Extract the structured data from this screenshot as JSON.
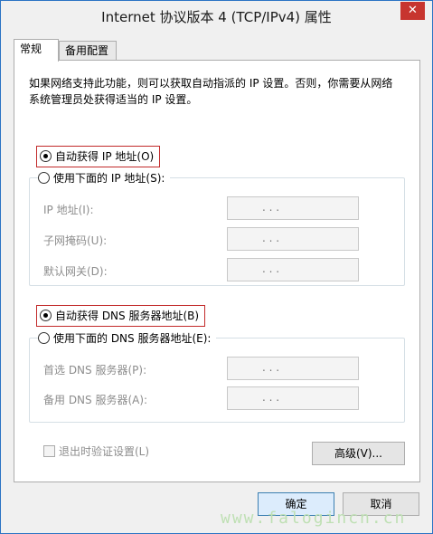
{
  "window": {
    "title": "Internet 协议版本 4 (TCP/IPv4) 属性",
    "close_glyph": "✕"
  },
  "tabs": [
    {
      "label": "常规"
    },
    {
      "label": "备用配置"
    }
  ],
  "description": "如果网络支持此功能，则可以获取自动指派的 IP 设置。否则，你需要从网络系统管理员处获得适当的 IP 设置。",
  "ip": {
    "auto_label": "自动获得 IP 地址(O)",
    "auto_selected": true,
    "manual_label": "使用下面的 IP 地址(S):",
    "fields": [
      {
        "label": "IP 地址(I):",
        "value": ". . ."
      },
      {
        "label": "子网掩码(U):",
        "value": ". . ."
      },
      {
        "label": "默认网关(D):",
        "value": ". . ."
      }
    ]
  },
  "dns": {
    "auto_label": "自动获得 DNS 服务器地址(B)",
    "auto_selected": true,
    "manual_label": "使用下面的 DNS 服务器地址(E):",
    "fields": [
      {
        "label": "首选 DNS 服务器(P):",
        "value": ". . ."
      },
      {
        "label": "备用 DNS 服务器(A):",
        "value": ". . ."
      }
    ]
  },
  "validate_label": "退出时验证设置(L)",
  "advanced_label": "高级(V)...",
  "ok_label": "确定",
  "cancel_label": "取消",
  "watermark": "www.falogincn.cn"
}
